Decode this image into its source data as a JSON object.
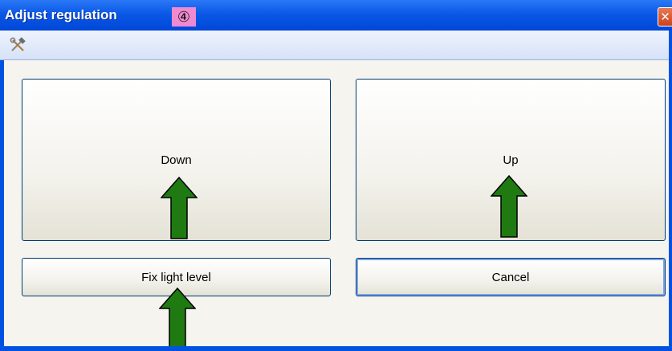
{
  "window": {
    "title": "Adjust regulation",
    "badge": "④",
    "close_glyph": "✕",
    "toolbar_icon": "tools-icon",
    "colors": {
      "titlebar": "#0a58e6",
      "frame": "#0053e1",
      "badge": "#f08ad0",
      "arrow": "#1f7a12"
    }
  },
  "buttons": {
    "down_label": "Down",
    "up_label": "Up",
    "fix_label": "Fix light level",
    "cancel_label": "Cancel"
  },
  "annotations": {
    "arrow_icon": "arrow-up-icon",
    "count": 3
  }
}
